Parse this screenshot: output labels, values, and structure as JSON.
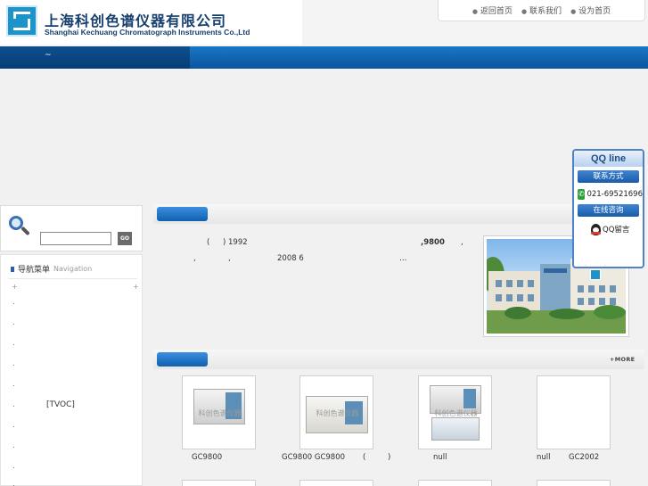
{
  "header": {
    "company_cn": "上海科创色谱仪器有限公司",
    "company_en": "Shanghai Kechuang Chromatograph Instruments Co.,Ltd",
    "links": [
      "返回首页",
      "联系我们",
      "设为首页"
    ]
  },
  "navbar": {
    "text": "~"
  },
  "search": {
    "value": "",
    "button": "GO"
  },
  "nav": {
    "title": "导航菜单",
    "subtitle": "Navigation",
    "plus": "+",
    "items": [
      {
        "bullet": ".",
        "label": ""
      },
      {
        "bullet": ".",
        "label": ""
      },
      {
        "bullet": ".",
        "label": ""
      },
      {
        "bullet": ".",
        "label": ""
      },
      {
        "bullet": ".",
        "label": ""
      },
      {
        "bullet": ".",
        "label": "[TVOC]"
      },
      {
        "bullet": ".",
        "label": ""
      },
      {
        "bullet": ".",
        "label": ""
      },
      {
        "bullet": ".",
        "label": ""
      },
      {
        "bullet": ".",
        "label": ""
      }
    ]
  },
  "about": {
    "paren": "(",
    "year": ")  1992",
    "model": ",9800",
    "comma1": ",",
    "comma2": ",",
    "comma3": ",",
    "date": "2008 6",
    "ellipsis": "…"
  },
  "products": {
    "more": "+MORE",
    "watermark": "科创色谱仪器",
    "captions": [
      "GC9800",
      "GC9800 GC9800",
      "(",
      ")",
      "null",
      "null",
      "GC2002"
    ]
  },
  "qq": {
    "title": "QQ line",
    "contact": "联系方式",
    "phone": "021-69521696",
    "consult": "在线咨询",
    "message": "QQ留言"
  }
}
